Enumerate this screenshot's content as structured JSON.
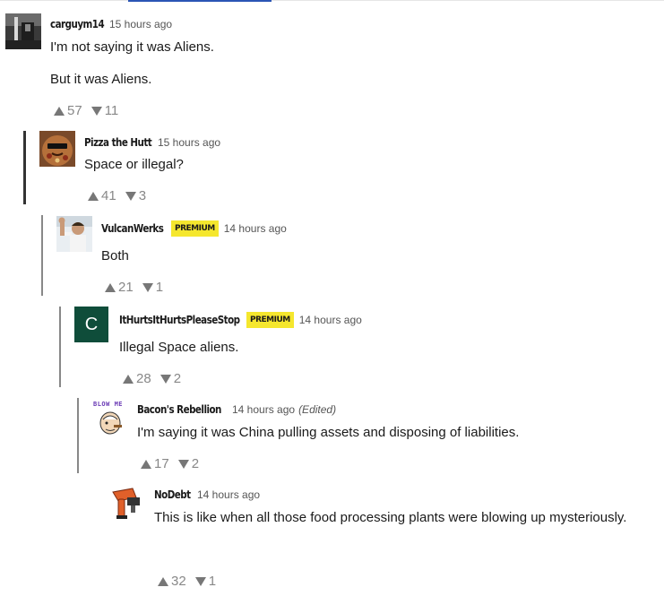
{
  "comments": [
    {
      "user": "carguym14",
      "time": "15 hours ago",
      "lines": [
        "I'm not saying it was Aliens.",
        "But it was Aliens."
      ],
      "up": "57",
      "down": "11"
    },
    {
      "user": "Pizza the Hutt",
      "time": "15 hours ago",
      "lines": [
        "Space or illegal?"
      ],
      "up": "41",
      "down": "3"
    },
    {
      "user": "VulcanWerks",
      "badge": "PREMIUM",
      "time": "14 hours ago",
      "lines": [
        "Both"
      ],
      "up": "21",
      "down": "1"
    },
    {
      "user": "ItHurtsItHurtsPleaseStop",
      "badge": "PREMIUM",
      "avatar_letter": "C",
      "time": "14 hours ago",
      "lines": [
        "Illegal Space aliens."
      ],
      "up": "28",
      "down": "2"
    },
    {
      "user": "Bacon's Rebellion",
      "time": "14 hours ago",
      "edited": "(Edited)",
      "avatar_text": "BLOW ME",
      "lines": [
        "I'm saying it was China pulling assets and disposing of liabilities."
      ],
      "up": "17",
      "down": "2"
    },
    {
      "user": "NoDebt",
      "time": "14 hours ago",
      "lines": [
        "This is like when all those food processing plants were blowing up mysteriously."
      ],
      "up": "32",
      "down": "1"
    }
  ],
  "colors": {
    "premium_badge": "#f5e72e",
    "letter_avatar_bg": "#0f4d3a",
    "vote_gray": "#888888"
  },
  "icons": {
    "upvote": "upvote-triangle-icon",
    "downvote": "downvote-triangle-icon"
  }
}
